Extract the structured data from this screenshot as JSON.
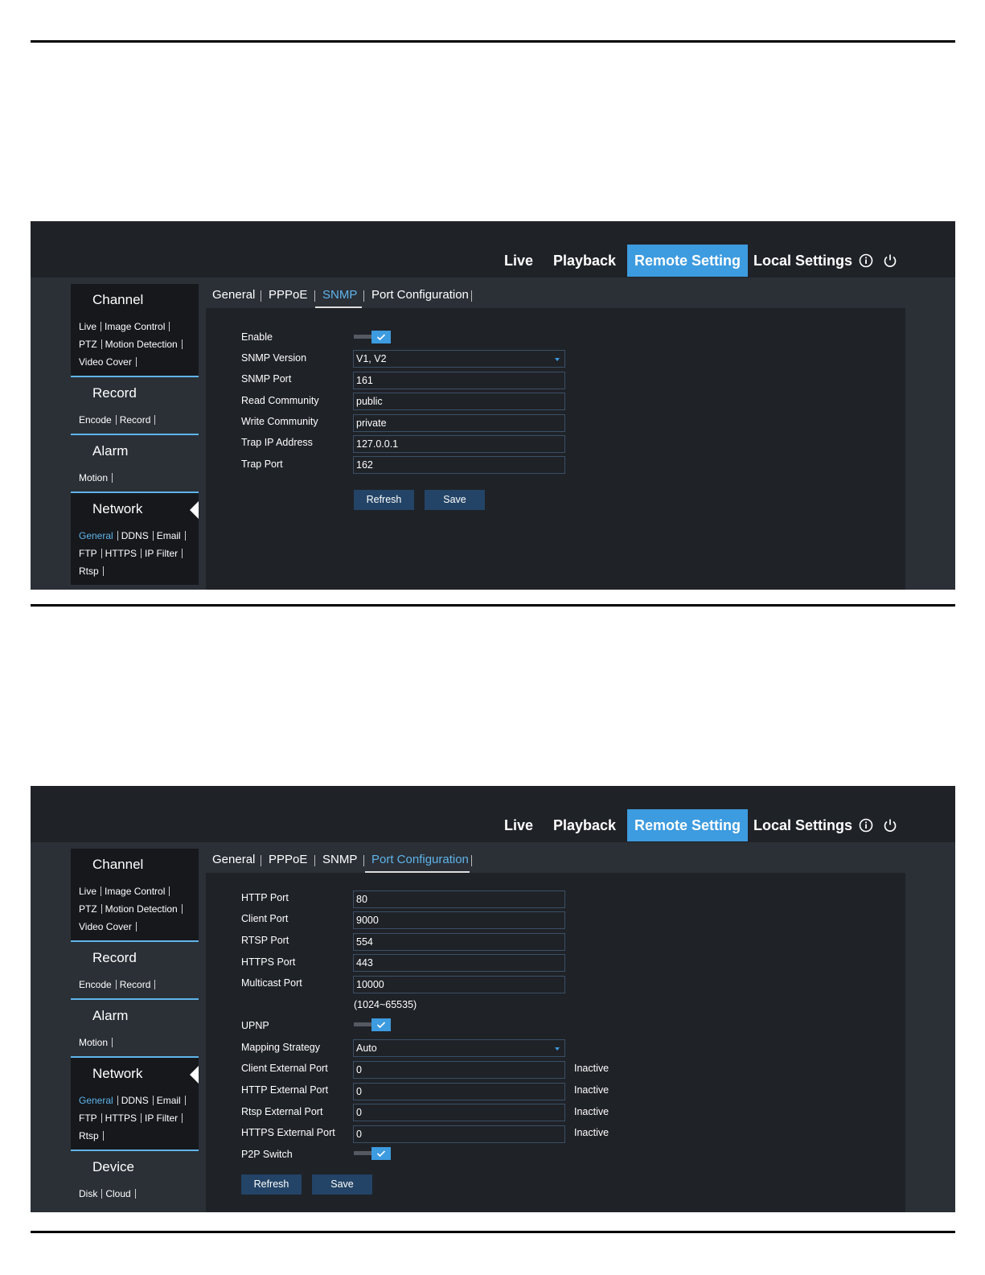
{
  "top_nav": {
    "live": "Live",
    "playback": "Playback",
    "remote_setting": "Remote Setting",
    "local_settings": "Local Settings",
    "info_icon": "info-icon",
    "power_icon": "power-icon"
  },
  "sidebar": {
    "channel": {
      "title": "Channel",
      "links": [
        "Live",
        "Image Control",
        "PTZ",
        "Motion Detection",
        "Video Cover"
      ]
    },
    "record": {
      "title": "Record",
      "links": [
        "Encode",
        "Record"
      ]
    },
    "alarm": {
      "title": "Alarm",
      "links": [
        "Motion"
      ]
    },
    "network": {
      "title": "Network",
      "links": [
        "General",
        "DDNS",
        "Email",
        "FTP",
        "HTTPS",
        "IP Filter",
        "Rtsp"
      ]
    },
    "device": {
      "title": "Device",
      "links": [
        "Disk",
        "Cloud"
      ]
    }
  },
  "tabs": [
    "General",
    "PPPoE",
    "SNMP",
    "Port Configuration"
  ],
  "snmp": {
    "enable_label": "Enable",
    "enable_checked": true,
    "version_label": "SNMP Version",
    "version_value": "V1, V2",
    "port_label": "SNMP Port",
    "port_value": "161",
    "read_label": "Read Community",
    "read_value": "public",
    "write_label": "Write Community",
    "write_value": "private",
    "trap_ip_label": "Trap IP Address",
    "trap_ip_value": "127.0.0.1",
    "trap_port_label": "Trap Port",
    "trap_port_value": "162",
    "refresh": "Refresh",
    "save": "Save"
  },
  "port_config": {
    "http_label": "HTTP Port",
    "http_value": "80",
    "client_label": "Client Port",
    "client_value": "9000",
    "rtsp_label": "RTSP Port",
    "rtsp_value": "554",
    "https_label": "HTTPS Port",
    "https_value": "443",
    "multicast_label": "Multicast Port",
    "multicast_value": "10000",
    "range_hint": "(1024~65535)",
    "upnp_label": "UPNP",
    "mapping_label": "Mapping Strategy",
    "mapping_value": "Auto",
    "client_ext_label": "Client External Port",
    "client_ext_value": "0",
    "http_ext_label": "HTTP External Port",
    "http_ext_value": "0",
    "rtsp_ext_label": "Rtsp External Port",
    "rtsp_ext_value": "0",
    "https_ext_label": "HTTPS External Port",
    "https_ext_value": "0",
    "inactive": "Inactive",
    "p2p_label": "P2P Switch",
    "refresh": "Refresh",
    "save": "Save"
  },
  "colors": {
    "accent": "#3d9be0",
    "panel_bg": "#1f2227",
    "sidebar_bg": "#2b3037",
    "button_bg": "#234466"
  }
}
